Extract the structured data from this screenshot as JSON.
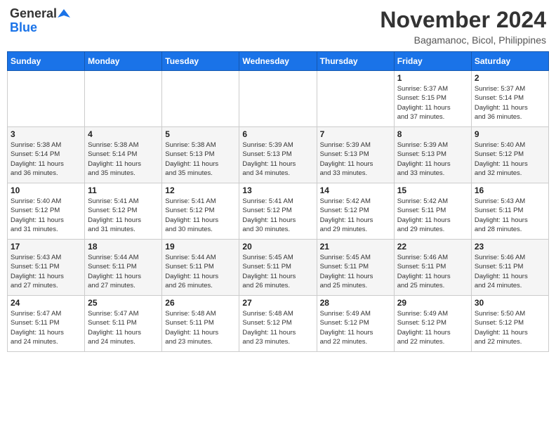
{
  "header": {
    "logo_general": "General",
    "logo_blue": "Blue",
    "month_title": "November 2024",
    "location": "Bagamanoc, Bicol, Philippines"
  },
  "weekdays": [
    "Sunday",
    "Monday",
    "Tuesday",
    "Wednesday",
    "Thursday",
    "Friday",
    "Saturday"
  ],
  "weeks": [
    [
      {
        "day": "",
        "info": ""
      },
      {
        "day": "",
        "info": ""
      },
      {
        "day": "",
        "info": ""
      },
      {
        "day": "",
        "info": ""
      },
      {
        "day": "",
        "info": ""
      },
      {
        "day": "1",
        "info": "Sunrise: 5:37 AM\nSunset: 5:15 PM\nDaylight: 11 hours\nand 37 minutes."
      },
      {
        "day": "2",
        "info": "Sunrise: 5:37 AM\nSunset: 5:14 PM\nDaylight: 11 hours\nand 36 minutes."
      }
    ],
    [
      {
        "day": "3",
        "info": "Sunrise: 5:38 AM\nSunset: 5:14 PM\nDaylight: 11 hours\nand 36 minutes."
      },
      {
        "day": "4",
        "info": "Sunrise: 5:38 AM\nSunset: 5:14 PM\nDaylight: 11 hours\nand 35 minutes."
      },
      {
        "day": "5",
        "info": "Sunrise: 5:38 AM\nSunset: 5:13 PM\nDaylight: 11 hours\nand 35 minutes."
      },
      {
        "day": "6",
        "info": "Sunrise: 5:39 AM\nSunset: 5:13 PM\nDaylight: 11 hours\nand 34 minutes."
      },
      {
        "day": "7",
        "info": "Sunrise: 5:39 AM\nSunset: 5:13 PM\nDaylight: 11 hours\nand 33 minutes."
      },
      {
        "day": "8",
        "info": "Sunrise: 5:39 AM\nSunset: 5:13 PM\nDaylight: 11 hours\nand 33 minutes."
      },
      {
        "day": "9",
        "info": "Sunrise: 5:40 AM\nSunset: 5:12 PM\nDaylight: 11 hours\nand 32 minutes."
      }
    ],
    [
      {
        "day": "10",
        "info": "Sunrise: 5:40 AM\nSunset: 5:12 PM\nDaylight: 11 hours\nand 31 minutes."
      },
      {
        "day": "11",
        "info": "Sunrise: 5:41 AM\nSunset: 5:12 PM\nDaylight: 11 hours\nand 31 minutes."
      },
      {
        "day": "12",
        "info": "Sunrise: 5:41 AM\nSunset: 5:12 PM\nDaylight: 11 hours\nand 30 minutes."
      },
      {
        "day": "13",
        "info": "Sunrise: 5:41 AM\nSunset: 5:12 PM\nDaylight: 11 hours\nand 30 minutes."
      },
      {
        "day": "14",
        "info": "Sunrise: 5:42 AM\nSunset: 5:12 PM\nDaylight: 11 hours\nand 29 minutes."
      },
      {
        "day": "15",
        "info": "Sunrise: 5:42 AM\nSunset: 5:11 PM\nDaylight: 11 hours\nand 29 minutes."
      },
      {
        "day": "16",
        "info": "Sunrise: 5:43 AM\nSunset: 5:11 PM\nDaylight: 11 hours\nand 28 minutes."
      }
    ],
    [
      {
        "day": "17",
        "info": "Sunrise: 5:43 AM\nSunset: 5:11 PM\nDaylight: 11 hours\nand 27 minutes."
      },
      {
        "day": "18",
        "info": "Sunrise: 5:44 AM\nSunset: 5:11 PM\nDaylight: 11 hours\nand 27 minutes."
      },
      {
        "day": "19",
        "info": "Sunrise: 5:44 AM\nSunset: 5:11 PM\nDaylight: 11 hours\nand 26 minutes."
      },
      {
        "day": "20",
        "info": "Sunrise: 5:45 AM\nSunset: 5:11 PM\nDaylight: 11 hours\nand 26 minutes."
      },
      {
        "day": "21",
        "info": "Sunrise: 5:45 AM\nSunset: 5:11 PM\nDaylight: 11 hours\nand 25 minutes."
      },
      {
        "day": "22",
        "info": "Sunrise: 5:46 AM\nSunset: 5:11 PM\nDaylight: 11 hours\nand 25 minutes."
      },
      {
        "day": "23",
        "info": "Sunrise: 5:46 AM\nSunset: 5:11 PM\nDaylight: 11 hours\nand 24 minutes."
      }
    ],
    [
      {
        "day": "24",
        "info": "Sunrise: 5:47 AM\nSunset: 5:11 PM\nDaylight: 11 hours\nand 24 minutes."
      },
      {
        "day": "25",
        "info": "Sunrise: 5:47 AM\nSunset: 5:11 PM\nDaylight: 11 hours\nand 24 minutes."
      },
      {
        "day": "26",
        "info": "Sunrise: 5:48 AM\nSunset: 5:11 PM\nDaylight: 11 hours\nand 23 minutes."
      },
      {
        "day": "27",
        "info": "Sunrise: 5:48 AM\nSunset: 5:12 PM\nDaylight: 11 hours\nand 23 minutes."
      },
      {
        "day": "28",
        "info": "Sunrise: 5:49 AM\nSunset: 5:12 PM\nDaylight: 11 hours\nand 22 minutes."
      },
      {
        "day": "29",
        "info": "Sunrise: 5:49 AM\nSunset: 5:12 PM\nDaylight: 11 hours\nand 22 minutes."
      },
      {
        "day": "30",
        "info": "Sunrise: 5:50 AM\nSunset: 5:12 PM\nDaylight: 11 hours\nand 22 minutes."
      }
    ]
  ]
}
